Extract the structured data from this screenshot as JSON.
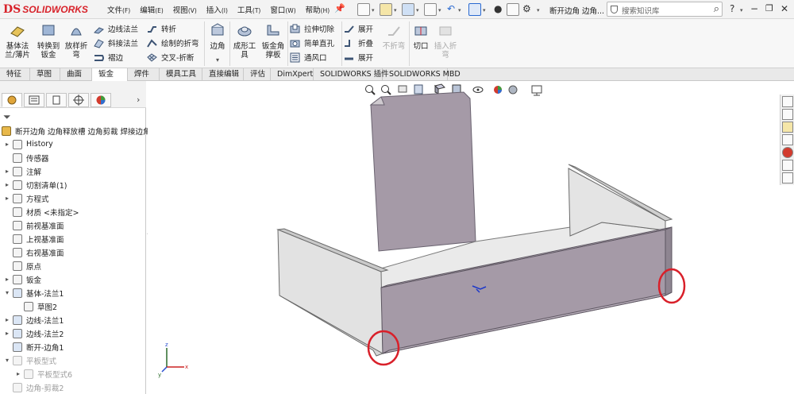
{
  "app": {
    "logo_prefix": "DS",
    "logo_text": "SOLIDWORKS"
  },
  "menus": [
    {
      "label": "文件",
      "key": "(F)"
    },
    {
      "label": "编辑",
      "key": "(E)"
    },
    {
      "label": "视图",
      "key": "(V)"
    },
    {
      "label": "插入",
      "key": "(I)"
    },
    {
      "label": "工具",
      "key": "(T)"
    },
    {
      "label": "窗口",
      "key": "(W)"
    },
    {
      "label": "帮助",
      "key": "(H)"
    }
  ],
  "titlebar": {
    "doc_title": "断开边角 边角...",
    "search_placeholder": "搜索知识库"
  },
  "ribbon": {
    "base_flange": "基体法\n兰/薄片",
    "convert_to_sheet": "转换到\n钣金",
    "lofted_bend": "放样折\n弯",
    "edge_flange": "边线法兰",
    "miter_flange": "斜接法兰",
    "hem": "褶边",
    "jog": "转折",
    "sketched_bend": "绘制的折弯",
    "cross_break": "交叉-折断",
    "corners": "边角",
    "forming_tool": "成形工\n具",
    "gusset": "钣金角\n撑板",
    "extruded_cut": "拉伸切除",
    "simple_hole": "简单直孔",
    "vent": "通风口",
    "unfold": "展开",
    "fold": "折叠",
    "flatten": "展开",
    "no_bends": "不折弯",
    "rip": "切口",
    "insert_bends": "插入折\n弯"
  },
  "tabs": [
    "特征",
    "草图",
    "曲面",
    "钣金",
    "焊件",
    "模具工具",
    "直接编辑",
    "评估",
    "DimXpert",
    "SOLIDWORKS 插件",
    "SOLIDWORKS MBD"
  ],
  "active_tab": "钣金",
  "tree": {
    "root": "断开边角 边角释放槽 边角剪裁 焊接边角 (",
    "items": [
      {
        "label": "History",
        "expand": "▸"
      },
      {
        "label": "传感器",
        "expand": ""
      },
      {
        "label": "注解",
        "expand": "▸"
      },
      {
        "label": "切割清单(1)",
        "expand": "▸"
      },
      {
        "label": "方程式",
        "expand": "▸"
      },
      {
        "label": "材质 <未指定>",
        "expand": ""
      },
      {
        "label": "前视基准面",
        "expand": ""
      },
      {
        "label": "上视基准面",
        "expand": ""
      },
      {
        "label": "右视基准面",
        "expand": ""
      },
      {
        "label": "原点",
        "expand": ""
      },
      {
        "label": "钣金",
        "expand": "▸"
      },
      {
        "label": "基体-法兰1",
        "expand": "▾"
      },
      {
        "label": "草图2",
        "expand": ""
      },
      {
        "label": "边线-法兰1",
        "expand": "▸"
      },
      {
        "label": "边线-法兰2",
        "expand": "▸"
      },
      {
        "label": "断开-边角1",
        "expand": ""
      },
      {
        "label": "平板型式",
        "expand": "▾"
      },
      {
        "label": "平板型式6",
        "expand": "▸"
      },
      {
        "label": "边角-剪裁2",
        "expand": ""
      }
    ]
  },
  "colors": {
    "face": "#a59aa7",
    "inner": "#e4e4e4",
    "highlight": "#d9202a",
    "brand": "#d8222a"
  }
}
